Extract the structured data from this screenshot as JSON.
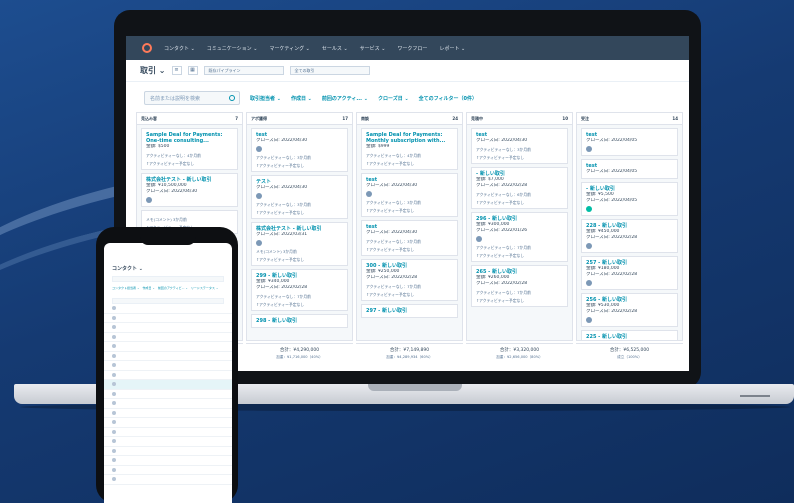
{
  "nav": {
    "items": [
      "コンタクト ⌄",
      "コミュニケーション ⌄",
      "マーケティング ⌄",
      "セールス ⌄",
      "サービス ⌄",
      "ワークフロー",
      "レポート ⌄"
    ]
  },
  "toolbar": {
    "title": "取引 ⌄",
    "pipeline": "既存パイプライン",
    "owner": "全ての取引"
  },
  "filters": {
    "search_placeholder": "名前または説明を検索",
    "items": [
      "取引担当者 ⌄",
      "作成日 ⌄",
      "前回のアクティ... ⌄",
      "クローズ日 ⌄",
      "全てのフィルター（0件）"
    ]
  },
  "columns": [
    {
      "name": "見込み客",
      "count": "7",
      "cards": [
        {
          "title": "Sample Deal for Payments: One-time consulting...",
          "lines": [
            "金額: $500"
          ],
          "acts": [
            "アクティビティーなし：4か月前",
            "↑アクティビティー予定なし"
          ],
          "badge": false
        },
        {
          "title": "株式会社テスト - 新しい取引",
          "lines": [
            "金額: ¥10,500,000",
            "クローズ日: 2022/04/30"
          ],
          "acts": [],
          "badge": true
        },
        {
          "title": "",
          "lines": [],
          "acts": [
            "メモ(コメント) 3か月前",
            "↑アクティビティー予定なし"
          ],
          "badge": false
        }
      ]
    },
    {
      "name": "アポ獲得",
      "count": "17",
      "cards": [
        {
          "title": "test",
          "lines": [
            "クローズ日: 2022/04/30"
          ],
          "acts": [
            "アクティビティーなし：3か月前",
            "↑アクティビティー予定なし"
          ],
          "badge": true
        },
        {
          "title": "テスト",
          "lines": [
            "クローズ日: 2022/04/30"
          ],
          "acts": [
            "アクティビティーなし：3か月前",
            "↑アクティビティー予定なし"
          ],
          "badge": true
        },
        {
          "title": "株式会社テスト - 新しい取引",
          "lines": [
            "クローズ日: 2022/03/31"
          ],
          "acts": [
            "メモ(コメント) 3か月前",
            "↑アクティビティー予定なし"
          ],
          "badge": true
        },
        {
          "title": "299 - 新しい取引",
          "lines": [
            "金額: ¥340,000",
            "クローズ日: 2022/02/28"
          ],
          "acts": [
            "アクティビティーなし：7か月前",
            "↑アクティビティー予定なし"
          ],
          "badge": false
        },
        {
          "title": "298 - 新しい取引",
          "lines": [],
          "acts": [],
          "badge": false
        }
      ]
    },
    {
      "name": "商談",
      "count": "24",
      "cards": [
        {
          "title": "Sample Deal for Payments: Monthly subscription with...",
          "lines": [
            "金額: $999"
          ],
          "acts": [
            "アクティビティーなし：4か月前",
            "↑アクティビティー予定なし"
          ],
          "badge": false
        },
        {
          "title": "test",
          "lines": [
            "クローズ日: 2022/04/30"
          ],
          "acts": [
            "アクティビティーなし：3か月前",
            "↑アクティビティー予定なし"
          ],
          "badge": true
        },
        {
          "title": "test",
          "lines": [
            "クローズ日: 2022/04/30"
          ],
          "acts": [
            "アクティビティーなし：3か月前",
            "↑アクティビティー予定なし"
          ],
          "badge": false
        },
        {
          "title": "300 - 新しい取引",
          "lines": [
            "金額: ¥250,000",
            "クローズ日: 2022/02/28"
          ],
          "acts": [
            "アクティビティーなし：7か月前",
            "↑アクティビティー予定なし"
          ],
          "badge": false
        },
        {
          "title": "297 - 新しい取引",
          "lines": [],
          "acts": [],
          "badge": false
        }
      ]
    },
    {
      "name": "見積中",
      "count": "10",
      "cards": [
        {
          "title": "test",
          "lines": [
            "クローズ日: 2022/04/30"
          ],
          "acts": [
            "アクティビティーなし：3か月前",
            "↑アクティビティー予定なし"
          ],
          "badge": false
        },
        {
          "title": "- 新しい取引",
          "lines": [
            "金額: $7,000",
            "クローズ日: 2022/02/28"
          ],
          "acts": [
            "アクティビティーなし：6か月前",
            "↑アクティビティー予定なし"
          ],
          "badge": false
        },
        {
          "title": "296 - 新しい取引",
          "lines": [
            "金額: ¥300,000",
            "クローズ日: 2022/01/26"
          ],
          "acts": [
            "アクティビティーなし：7か月前",
            "↑アクティビティー予定なし"
          ],
          "badge": true
        },
        {
          "title": "265 - 新しい取引",
          "lines": [
            "金額: ¥260,000",
            "クローズ日: 2022/02/28"
          ],
          "acts": [
            "アクティビティーなし：7か月前",
            "↑アクティビティー予定なし"
          ],
          "badge": false
        }
      ]
    },
    {
      "name": "受注",
      "count": "14",
      "cards": [
        {
          "title": "test",
          "lines": [
            "クローズ日: 2022/04/05"
          ],
          "acts": [],
          "badge": true
        },
        {
          "title": "test",
          "lines": [
            "クローズ日: 2022/04/05"
          ],
          "acts": [],
          "badge": false
        },
        {
          "title": "- 新しい取引",
          "lines": [
            "金額: ¥5,500",
            "クローズ日: 2022/04/05"
          ],
          "acts": [],
          "badge": true
        },
        {
          "title": "228 - 新しい取引",
          "lines": [
            "金額: ¥450,000",
            "クローズ日: 2022/02/28"
          ],
          "acts": [],
          "badge": true
        },
        {
          "title": "257 - 新しい取引",
          "lines": [
            "金額: ¥180,000",
            "クローズ日: 2022/02/28"
          ],
          "acts": [],
          "badge": true
        },
        {
          "title": "256 - 新しい取引",
          "lines": [
            "金額: ¥530,000",
            "クローズ日: 2022/02/28"
          ],
          "acts": [],
          "badge": true
        },
        {
          "title": "225 - 新しい取引",
          "lines": [],
          "acts": [],
          "badge": false
        }
      ]
    }
  ],
  "totals": [
    {
      "main": "",
      "sub": ""
    },
    {
      "main": "合計：¥4,290,000",
      "sub": "加重：¥1,716,000（40%）"
    },
    {
      "main": "合計：¥7,149,890",
      "sub": "加重：¥4,289,934（60%）"
    },
    {
      "main": "合計：¥3,320,000",
      "sub": "加重：¥2,656,000（80%）"
    },
    {
      "main": "合計：¥6,525,000",
      "sub": "成立（100%）"
    }
  ],
  "phone": {
    "title": "コンタクト ⌄",
    "filter_text": "コンタクト担当者 ⌄　作成日 ⌄　前回のアクティビ... ⌄　リードステータス ⌄"
  },
  "colors": {
    "accent": "#0091ae",
    "nav": "#33475b",
    "brand": "#ff7a59"
  }
}
